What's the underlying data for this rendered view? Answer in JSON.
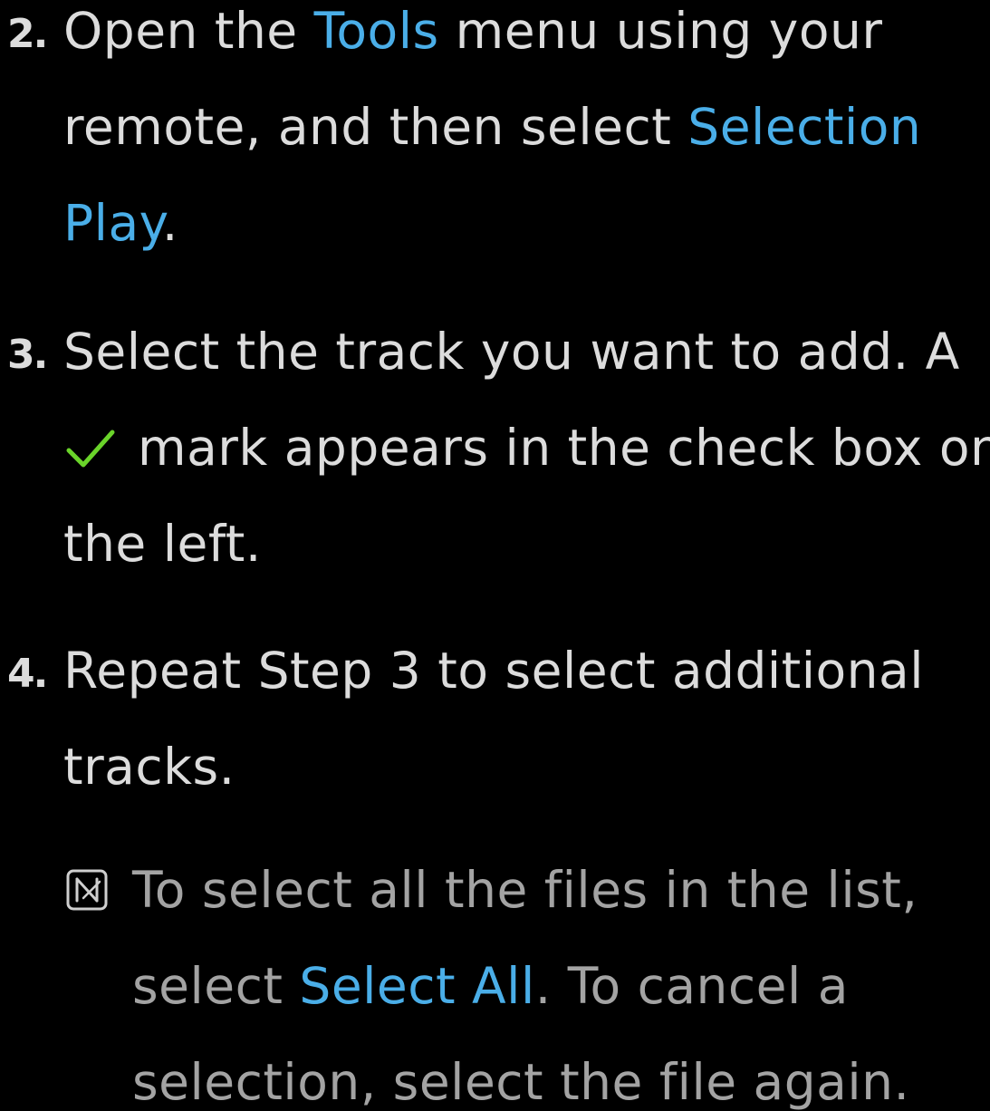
{
  "steps": [
    {
      "number": "2.",
      "lines": [
        {
          "pre": "Open the ",
          "hl": "Tools",
          "post": " menu using your"
        },
        {
          "pre": "remote, and then select ",
          "hl": "Selection",
          "post": ""
        },
        {
          "pre": "",
          "hl": "Play",
          "post": "."
        }
      ]
    },
    {
      "number": "3.",
      "lines": [
        {
          "text": "Select the track you want to add. A"
        },
        {
          "text": "mark appears in the check box on"
        },
        {
          "text": "the left."
        }
      ]
    },
    {
      "number": "4.",
      "lines": [
        {
          "text": "Repeat Step 3 to select additional"
        },
        {
          "text": "tracks."
        }
      ]
    }
  ],
  "note": {
    "icon": "note-icon",
    "line1": "To select all the files in the list,",
    "line2_pre": "select ",
    "line2_hl": "Select All",
    "line2_post": ". To cancel a",
    "line3": "selection, select the file again."
  },
  "icons": {
    "check": "checkmark-icon",
    "note": "note-icon"
  },
  "colors": {
    "background": "#000000",
    "text": "#dcdcdc",
    "highlight": "#4aaee8",
    "note_text": "#a3a3a3",
    "checkmark": "#6ad42a"
  }
}
